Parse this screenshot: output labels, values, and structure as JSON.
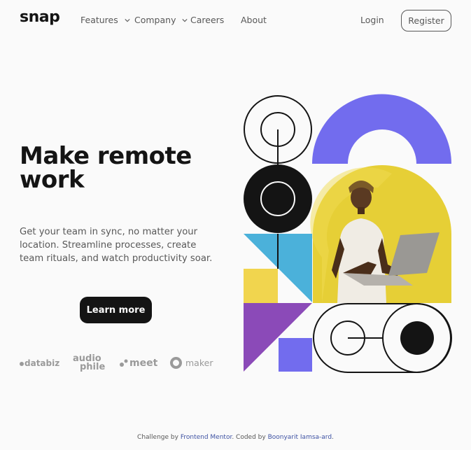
{
  "header": {
    "logo": "snap",
    "nav": [
      {
        "label": "Features",
        "has_dropdown": true
      },
      {
        "label": "Company",
        "has_dropdown": true
      },
      {
        "label": "Careers",
        "has_dropdown": false
      },
      {
        "label": "About",
        "has_dropdown": false
      }
    ],
    "login": "Login",
    "register": "Register"
  },
  "hero": {
    "title_line1": "Make remote",
    "title_line2": "work",
    "description": "Get your team in sync, no matter your location. Streamline processes, create team rituals, and watch productivity soar.",
    "cta": "Learn more"
  },
  "clients": [
    {
      "name": "databiz",
      "icon": "databiz-logo"
    },
    {
      "name": "audiophile",
      "icon": "audiophile-logo"
    },
    {
      "name": "meet",
      "icon": "meet-logo"
    },
    {
      "name": "maker",
      "icon": "maker-logo"
    }
  ],
  "footer": {
    "prefix": "Challenge by",
    "link1": "Frontend Mentor",
    "middle": ". Coded by",
    "link2": "Boonyarit Iamsa-ard",
    "suffix": "."
  },
  "colors": {
    "dark": "#141414",
    "gray": "#585858",
    "background": "#fafafa",
    "purple": "#726cee",
    "blue": "#4bb1da",
    "yellow": "#f1d54e",
    "violet": "#8b4ab8"
  }
}
